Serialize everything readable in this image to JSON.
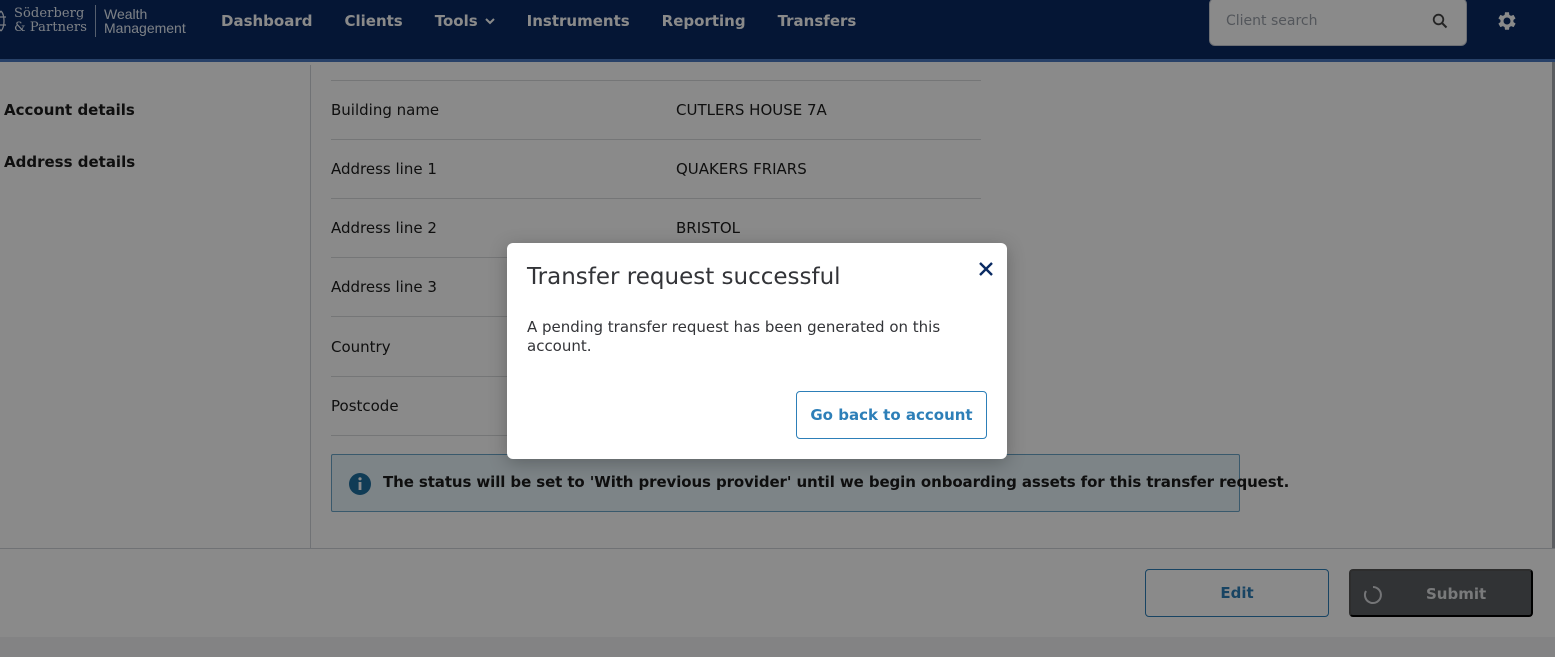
{
  "brand": {
    "line1": "Söderberg",
    "line2": "& Partners",
    "product1": "Wealth",
    "product2": "Management"
  },
  "nav": {
    "items": [
      {
        "label": "Dashboard"
      },
      {
        "label": "Clients"
      },
      {
        "label": "Tools"
      },
      {
        "label": "Instruments"
      },
      {
        "label": "Reporting"
      },
      {
        "label": "Transfers"
      }
    ]
  },
  "search": {
    "placeholder": "Client search"
  },
  "sidebar": {
    "items": [
      {
        "label": "Account details"
      },
      {
        "label": "Address details"
      }
    ]
  },
  "address": {
    "rows": [
      {
        "label": "Building name",
        "value": "CUTLERS HOUSE 7A"
      },
      {
        "label": "Address line 1",
        "value": "QUAKERS FRIARS"
      },
      {
        "label": "Address line 2",
        "value": "BRISTOL"
      },
      {
        "label": "Address line 3",
        "value": ""
      },
      {
        "label": "Country",
        "value": ""
      },
      {
        "label": "Postcode",
        "value": ""
      }
    ]
  },
  "info": {
    "text": "The status will be set to 'With previous provider' until we begin onboarding assets for this transfer request."
  },
  "footer": {
    "edit_label": "Edit",
    "submit_label": "Submit"
  },
  "modal": {
    "title": "Transfer request successful",
    "body": "A pending transfer request has been generated on this account.",
    "button_label": "Go back to account"
  },
  "colors": {
    "header_bg": "#0a2a62",
    "accent": "#2d7fb8",
    "info_bg": "#e7f4fa"
  }
}
